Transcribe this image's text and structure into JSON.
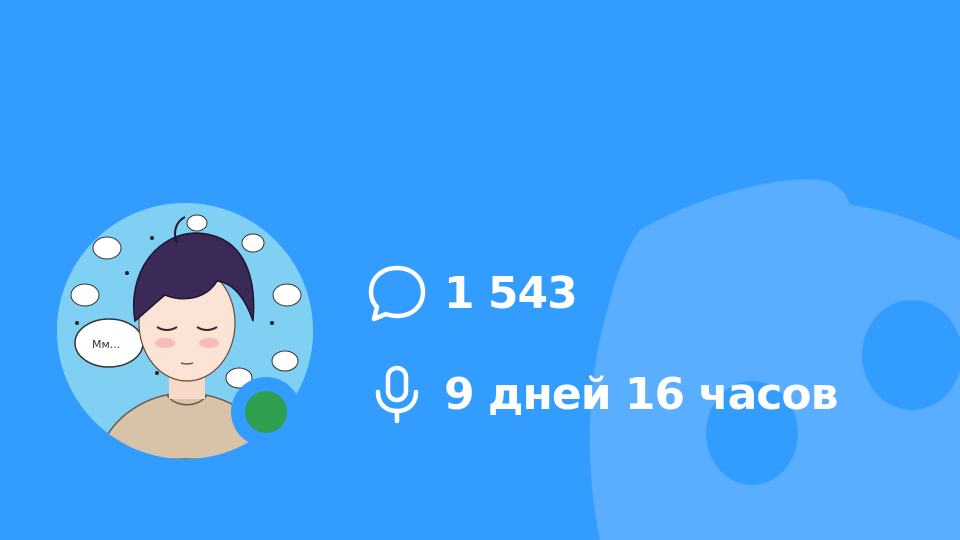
{
  "profile": {
    "avatar": "user-avatar",
    "status": "online",
    "status_color": "#2f9e4f"
  },
  "stats": {
    "messages": {
      "icon": "chat-bubble-icon",
      "value": "1 543"
    },
    "voice": {
      "icon": "microphone-icon",
      "value": "9 дней 16 часов"
    }
  },
  "colors": {
    "background": "#329cff",
    "logo_watermark": "#5aaeff",
    "text": "#ffffff"
  }
}
